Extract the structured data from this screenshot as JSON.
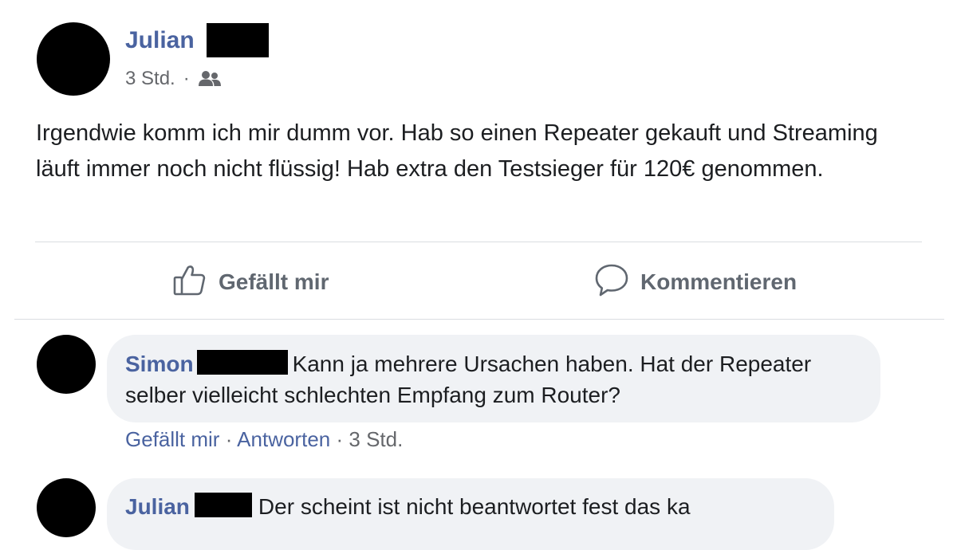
{
  "post": {
    "author": "Julian",
    "time": "3 Std.",
    "meta_separator": "·",
    "audience_icon": "friends-icon",
    "text": "Irgendwie komm ich mir dumm vor. Hab so einen Repeater gekauft und Streaming läuft immer noch nicht flüssig! Hab extra den Testsieger für 120€ genommen."
  },
  "actions": {
    "like_label": "Gefällt mir",
    "like_icon": "thumbs-up-icon",
    "comment_label": "Kommentieren",
    "comment_icon": "comment-bubble-icon"
  },
  "comments": [
    {
      "author": "Simon",
      "text": "Kann ja mehrere Ursachen haben. Hat der Repeater selber vielleicht schlechten Empfang zum Router?",
      "like_label": "Gefällt mir",
      "reply_label": "Antworten",
      "separator": "·",
      "time": "3 Std."
    },
    {
      "author": "Julian",
      "text": "Der scheint ist nicht beantwortet fest das ka"
    }
  ],
  "colors": {
    "link": "#4a63a0",
    "text": "#1c1e21",
    "secondary": "#65676b",
    "bubble": "#f0f2f5",
    "divider": "#dadde1"
  }
}
